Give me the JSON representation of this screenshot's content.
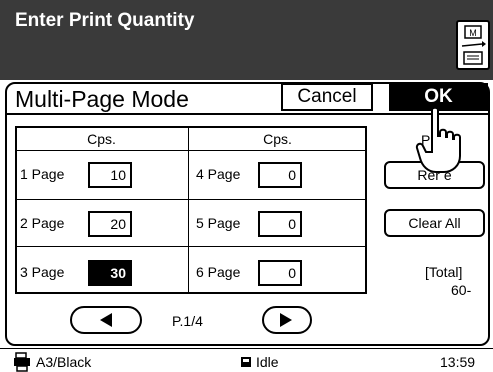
{
  "header": {
    "title": "Enter Print Quantity"
  },
  "mode_panel": {
    "title": "Multi-Page Mode",
    "cancel_label": "Cancel",
    "ok_label": "OK"
  },
  "table": {
    "col_left": "Cps.",
    "col_right": "Cps.",
    "rows_left": [
      {
        "label": "1 Page",
        "value": "10"
      },
      {
        "label": "2 Page",
        "value": "20"
      },
      {
        "label": "3 Page",
        "value": "30"
      }
    ],
    "rows_right": [
      {
        "label": "4 Page",
        "value": "0"
      },
      {
        "label": "5 Page",
        "value": "0"
      },
      {
        "label": "6 Page",
        "value": "0"
      }
    ]
  },
  "side": {
    "top_text": "P",
    "remove_label": "Rer  e",
    "clear_all_label": "Clear All",
    "total_label": "[Total]",
    "total_value": "60-"
  },
  "pagination": {
    "page_text": "P.1/4"
  },
  "status_bar": {
    "paper": "A3/Black",
    "state": "Idle",
    "time": "13:59"
  }
}
